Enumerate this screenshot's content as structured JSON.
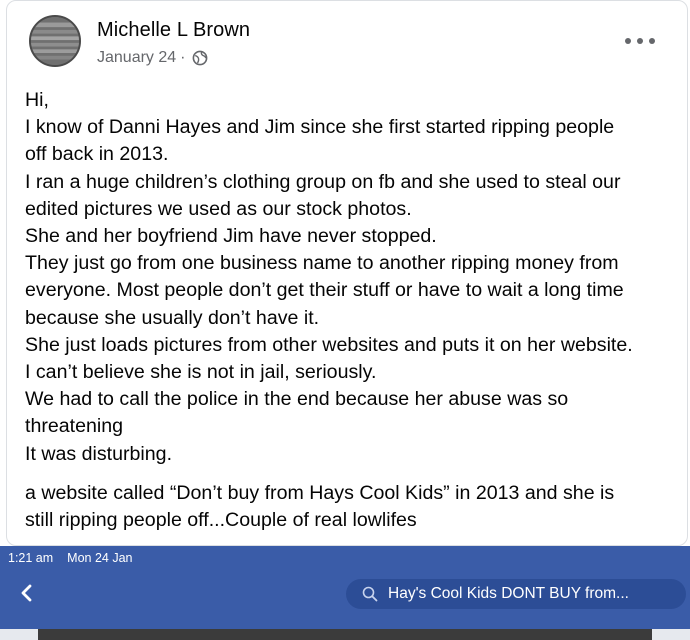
{
  "post": {
    "author": "Michelle L Brown",
    "date": "January 24",
    "separator": "·",
    "privacy_icon": "globe-icon",
    "more_icon": "more-options-icon",
    "lines": [
      "Hi,",
      "I know of Danni Hayes  and Jim since she first started ripping people",
      "off back in 2013.",
      "I ran a huge children’s clothing group on fb and she used to steal our",
      "edited pictures we used as our stock photos.",
      "She and her boyfriend Jim have never stopped.",
      "They just go from one business name to another ripping money from",
      "everyone. Most people don’t get their stuff or have to wait a long time",
      "because she usually don’t have it.",
      "She just loads pictures from other websites and puts it on her website.",
      "I can’t believe she is not in jail, seriously.",
      "We had to call the police in the end because her abuse was so",
      "threatening",
      "It was disturbing."
    ],
    "lines2": [
      "a website called “Don’t buy from Hays Cool Kids” in 2013 and she is",
      "still ripping people off...Couple of real lowlifes"
    ]
  },
  "phone": {
    "time": "1:21 am",
    "date": "Mon 24 Jan",
    "back_icon": "chevron-left-icon",
    "search_icon": "search-icon",
    "search_text": "Hay's Cool Kids DONT BUY from..."
  },
  "colors": {
    "bar": "#3a5ca8",
    "pill": "#2c4d96",
    "text": "#050505",
    "meta": "#65676b"
  }
}
